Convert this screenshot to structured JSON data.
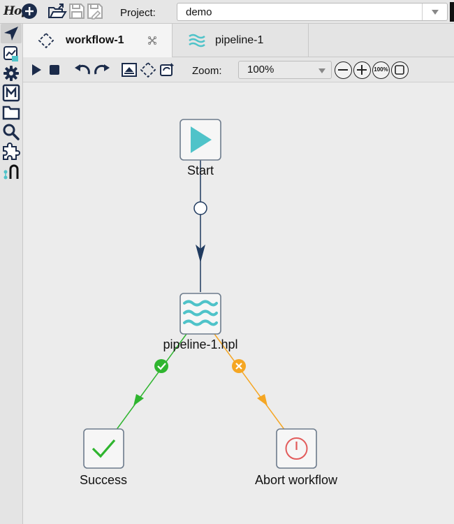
{
  "app": {
    "logo_text": "Hop"
  },
  "toolbar": {
    "project_label": "Project:",
    "project_value": "demo"
  },
  "tabs": [
    {
      "label": "workflow-1",
      "active": true,
      "icon": "workflow-icon"
    },
    {
      "label": "pipeline-1",
      "active": false,
      "icon": "pipeline-icon"
    }
  ],
  "workflow_toolbar": {
    "zoom_label": "Zoom:",
    "zoom_value": "100%",
    "zoom_100_label": "100%"
  },
  "canvas": {
    "nodes": [
      {
        "id": "start",
        "label": "Start",
        "icon": "play-icon"
      },
      {
        "id": "pipeline",
        "label": "pipeline-1.hpl",
        "icon": "pipeline-icon"
      },
      {
        "id": "success",
        "label": "Success",
        "icon": "check-icon"
      },
      {
        "id": "abort",
        "label": "Abort workflow",
        "icon": "abort-icon"
      }
    ],
    "hops": [
      {
        "from": "start",
        "to": "pipeline",
        "type": "unconditional",
        "color": "#1f3a5f"
      },
      {
        "from": "pipeline",
        "to": "success",
        "type": "success",
        "color": "#2fb52f"
      },
      {
        "from": "pipeline",
        "to": "abort",
        "type": "failure",
        "color": "#f5a623"
      }
    ]
  },
  "colors": {
    "accent_teal": "#4fc3c9",
    "success_green": "#2fb52f",
    "failure_orange": "#f5a623",
    "abort_red": "#e25b5b",
    "hop_navy": "#1f3a5f"
  }
}
